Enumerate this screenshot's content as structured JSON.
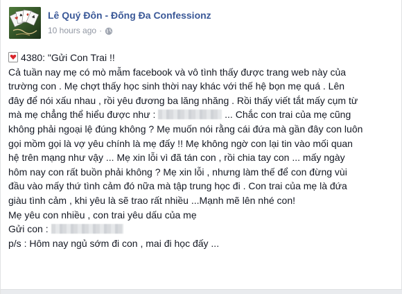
{
  "post": {
    "author": "Lê Quý Đôn - Đống Đa Confessionz",
    "timestamp": "10 hours ago",
    "separator": "·",
    "privacy_icon": "globe-icon",
    "avatar_icon": "playing-cards-avatar",
    "title_icon": "heart-card-icon",
    "title": "4380: \"Gửi Con Trai !!",
    "body_lines": [
      "Cả tuần nay mẹ có mò mẫm facebook và vô tình thấy được trang web này của",
      "trường con . Mẹ chợt thấy học sinh thời nay khác với thế hệ bọn mẹ quá . Lên",
      "đây để nói xấu nhau , rồi yêu đương ba lăng nhăng . Rồi thấy viết tắt mấy cụm từ"
    ],
    "line4_before": "mà mẹ chẳng thể hiểu được như :",
    "line4_after": "... Chắc con trai của mẹ cũng",
    "body_lines_2": [
      "không phải ngoại lệ đúng không ? Mẹ muốn nói rằng cái đứa mà gần đây con luôn",
      "gọi mồm gọi là vợ yêu chính là mẹ đấy !! Mẹ không ngờ con lại tin vào mối quan",
      "hệ trên mạng như vậy ... Mẹ xin lỗi vì đã tán con , rồi chia tay con ... mấy ngày",
      "hôm nay con rất buồn phải không ? Mẹ xin lỗi , nhưng làm thế để con đừng vùi",
      "đầu vào mấy thứ tình cảm đó nữa mà tập trung học đi . Con trai của mẹ là đứa",
      "giàu tình cảm , khi yêu là sẽ trao rất nhiều ...Mạnh mẽ lên nhé con!",
      "Mẹ yêu con nhiều , con trai yêu dấu của mẹ"
    ],
    "sign_label": "Gửi con :",
    "ps": "p/s : Hôm nay ngủ sớm đi con , mai đi học đấy ..."
  },
  "colors": {
    "author_link": "#3b5998",
    "meta_text": "#9197a3",
    "body_text": "#141823"
  }
}
